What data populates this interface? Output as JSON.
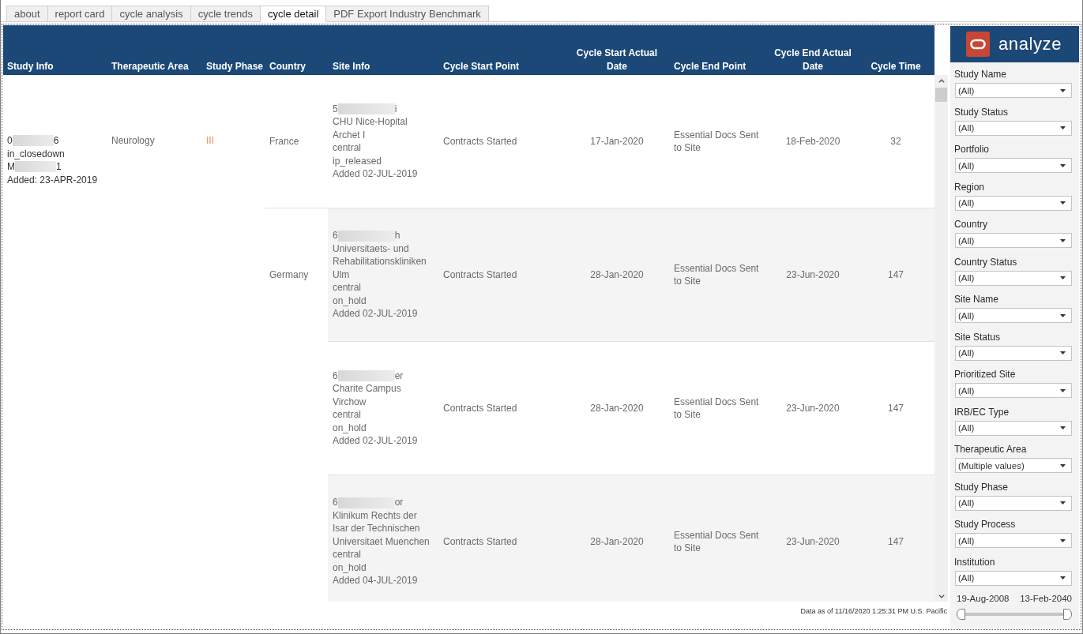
{
  "tabs": [
    {
      "label": "about",
      "selected": false
    },
    {
      "label": "report card",
      "selected": false
    },
    {
      "label": "cycle analysis",
      "selected": false
    },
    {
      "label": "cycle trends",
      "selected": false
    },
    {
      "label": "cycle detail",
      "selected": true
    },
    {
      "label": "PDF Export Industry Benchmark",
      "selected": false
    }
  ],
  "table": {
    "columns": [
      {
        "label": "Study Info",
        "kind": "text"
      },
      {
        "label": "Therapeutic Area",
        "kind": "text"
      },
      {
        "label": "Study Phase",
        "kind": "text"
      },
      {
        "label": "Country",
        "kind": "text"
      },
      {
        "label": "Site Info",
        "kind": "text"
      },
      {
        "label": "Cycle Start Point",
        "kind": "text"
      },
      {
        "label": "Cycle Start Actual Date",
        "kind": "date"
      },
      {
        "label": "Cycle End Point",
        "kind": "text"
      },
      {
        "label": "Cycle End Actual Date",
        "kind": "date"
      },
      {
        "label": "Cycle Time",
        "kind": "number"
      }
    ],
    "study": {
      "id": {
        "start": "0",
        "redacted": true,
        "end": "6"
      },
      "status": "in_closedown",
      "code": {
        "start": "M",
        "redacted": true,
        "end": "1"
      },
      "added": "Added: 23-APR-2019",
      "therapeutic_area": "Neurology",
      "phase": "III"
    },
    "countries": [
      {
        "name": "France",
        "sites": [
          {
            "id": {
              "start": "5",
              "redacted": true,
              "end": "i"
            },
            "name": "CHU Nice-Hopital Archet I",
            "region": "central",
            "status": "ip_released",
            "added": "Added 02-JUL-2019",
            "cycle_start_point": "Contracts Started",
            "cycle_start_date": "17-Jan-2020",
            "cycle_end_point": "Essential Docs Sent to Site",
            "cycle_end_date": "18-Feb-2020",
            "cycle_time": "32"
          }
        ]
      },
      {
        "name": "Germany",
        "sites": [
          {
            "id": {
              "start": "6",
              "redacted": true,
              "end": "h"
            },
            "name": "Universitaets- und Rehabilitationskliniken Ulm",
            "region": "central",
            "status": "on_hold",
            "added": "Added 02-JUL-2019",
            "cycle_start_point": "Contracts Started",
            "cycle_start_date": "28-Jan-2020",
            "cycle_end_point": "Essential Docs Sent to Site",
            "cycle_end_date": "23-Jun-2020",
            "cycle_time": "147"
          },
          {
            "id": {
              "start": "6",
              "redacted": true,
              "end": "er"
            },
            "name": "Charite Campus Virchow",
            "region": "central",
            "status": "on_hold",
            "added": "Added 02-JUL-2019",
            "cycle_start_point": "Contracts Started",
            "cycle_start_date": "28-Jan-2020",
            "cycle_end_point": "Essential Docs Sent to Site",
            "cycle_end_date": "23-Jun-2020",
            "cycle_time": "147"
          },
          {
            "id": {
              "start": "6",
              "redacted": true,
              "end": "or"
            },
            "name": "Klinikum Rechts der Isar der Technischen Universitaet Muenchen",
            "region": "central",
            "status": "on_hold",
            "added": "Added 04-JUL-2019",
            "cycle_start_point": "Contracts Started",
            "cycle_start_date": "28-Jan-2020",
            "cycle_end_point": "Essential Docs Sent to Site",
            "cycle_end_date": "23-Jun-2020",
            "cycle_time": "147"
          }
        ]
      }
    ]
  },
  "data_as_of": "Data as of 11/16/2020 1:25:31 PM U.S. Pacific",
  "sidebar": {
    "logo_text": "analyze",
    "filters": [
      {
        "label": "Study Name",
        "value": "(All)"
      },
      {
        "label": "Study Status",
        "value": "(All)"
      },
      {
        "label": "Portfolio",
        "value": "(All)"
      },
      {
        "label": "Region",
        "value": "(All)"
      },
      {
        "label": "Country",
        "value": "(All)"
      },
      {
        "label": "Country Status",
        "value": "(All)"
      },
      {
        "label": "Site Name",
        "value": "(All)"
      },
      {
        "label": "Site Status",
        "value": "(All)"
      },
      {
        "label": "Prioritized Site",
        "value": "(All)"
      },
      {
        "label": "IRB/EC Type",
        "value": "(All)"
      },
      {
        "label": "Therapeutic Area",
        "value": "(Multiple values)"
      },
      {
        "label": "Study Phase",
        "value": "(All)"
      },
      {
        "label": "Study Process",
        "value": "(All)"
      },
      {
        "label": "Institution",
        "value": "(All)"
      }
    ],
    "date_range": {
      "start": "19-Aug-2008",
      "end": "13-Feb-2040",
      "level": 1
    }
  }
}
